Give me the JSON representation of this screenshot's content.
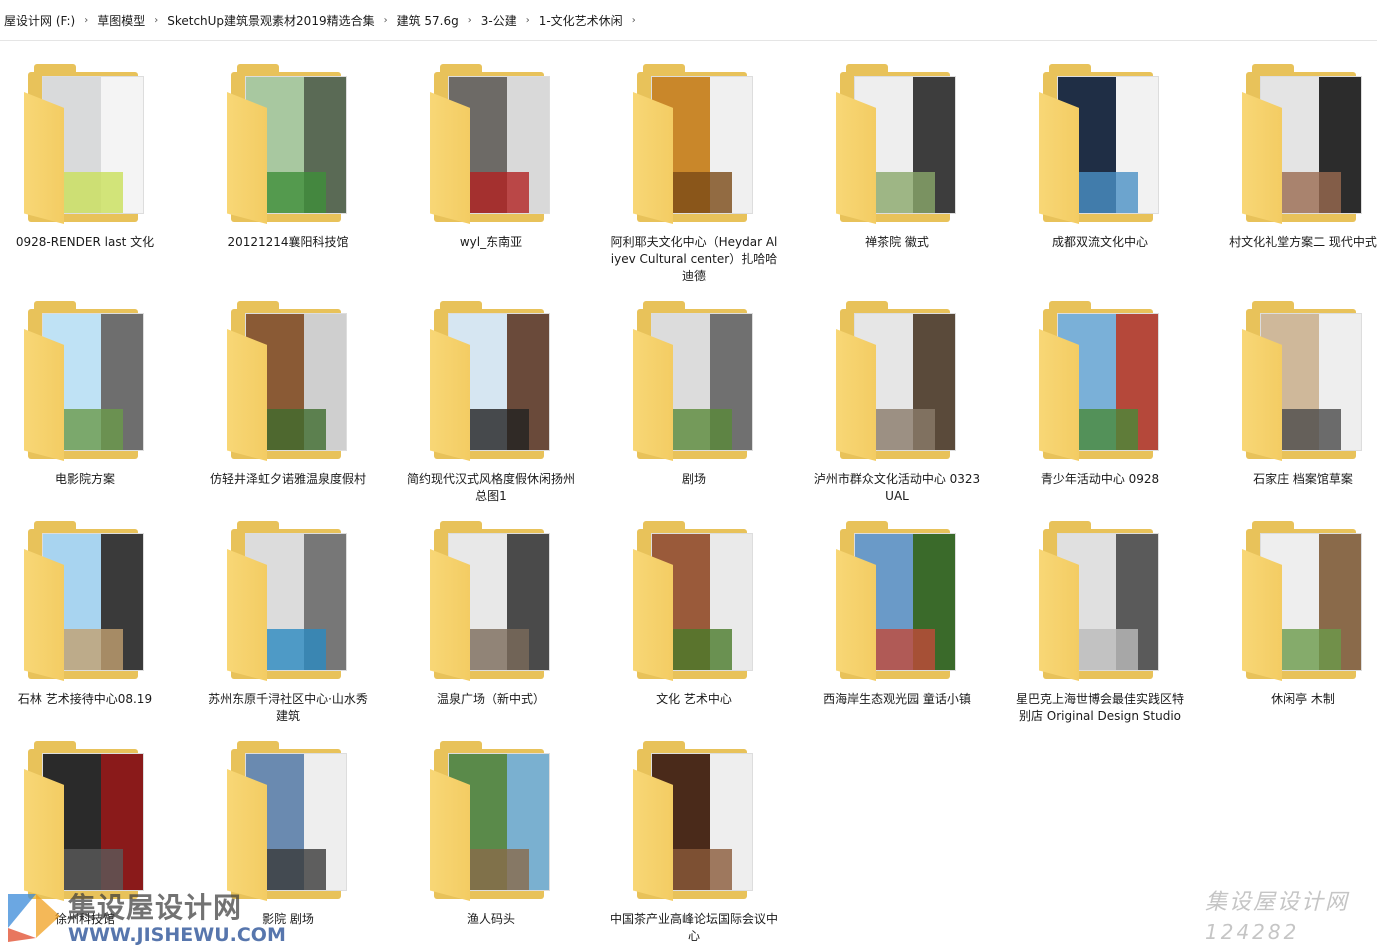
{
  "breadcrumb": [
    "屋设计网 (F:)",
    "草图模型",
    "SketchUp建筑景观素材2019精选合集",
    "建筑 57.6g",
    "3-公建",
    "1-文化艺术休闲"
  ],
  "folders": [
    {
      "name": "0928-RENDER last 文化",
      "colors": [
        "#d9dadb",
        "#f4f4f4",
        "#c9e05a"
      ]
    },
    {
      "name": "20121214襄阳科技馆",
      "colors": [
        "#a8c8a0",
        "#5a6a55",
        "#3f8f3a"
      ]
    },
    {
      "name": "wyl_东南亚",
      "colors": [
        "#6d6a66",
        "#d9d9d9",
        "#b22222"
      ]
    },
    {
      "name": "阿利耶夫文化中心（Heydar Aliyev Cultural center）扎哈哈迪德",
      "colors": [
        "#c9872a",
        "#f0f0f0",
        "#7a4a16"
      ]
    },
    {
      "name": "禅茶院 徽式",
      "colors": [
        "#eeeeee",
        "#3d3d3d",
        "#8aa86a"
      ]
    },
    {
      "name": "成都双流文化中心",
      "colors": [
        "#1f2e45",
        "#f2f2f2",
        "#4a90c4"
      ]
    },
    {
      "name": "村文化礼堂方案二 现代中式",
      "colors": [
        "#e4e4e4",
        "#2c2c2c",
        "#9a6a50"
      ]
    },
    {
      "name": "电影院方案",
      "colors": [
        "#bfe2f5",
        "#6e6e6e",
        "#6a9a4a"
      ]
    },
    {
      "name": "仿轻井泽虹夕诺雅温泉度假村",
      "colors": [
        "#8a5a35",
        "#cfcfcf",
        "#3e6b2e"
      ]
    },
    {
      "name": "简约现代汉式风格度假休闲扬州总图1",
      "colors": [
        "#d6e6f2",
        "#6a4a3a",
        "#222222"
      ]
    },
    {
      "name": "剧场",
      "colors": [
        "#dcdcdc",
        "#707070",
        "#5a8a3a"
      ]
    },
    {
      "name": "泸州市群众文化活动中心 0323 UAL",
      "colors": [
        "#e6e6e6",
        "#5a4a3a",
        "#8a7a6a"
      ]
    },
    {
      "name": "青少年活动中心 0928",
      "colors": [
        "#7ab0d8",
        "#b5483a",
        "#4a8a3a"
      ]
    },
    {
      "name": "石家庄 档案馆草案",
      "colors": [
        "#cfb89a",
        "#eeeeee",
        "#4a4a4a"
      ]
    },
    {
      "name": "石林 艺术接待中心08.19",
      "colors": [
        "#a8d4f0",
        "#3a3a3a",
        "#c2a070"
      ]
    },
    {
      "name": "苏州东原千浔社区中心·山水秀建筑",
      "colors": [
        "#dcdcdc",
        "#777777",
        "#2a8ac0"
      ]
    },
    {
      "name": "温泉广场（新中式）",
      "colors": [
        "#e8e8e8",
        "#4a4a4a",
        "#7a6a5a"
      ]
    },
    {
      "name": "文化 艺术中心",
      "colors": [
        "#9a5a3a",
        "#eaeaea",
        "#4a7a2a"
      ]
    },
    {
      "name": "西海岸生态观光园 童话小镇",
      "colors": [
        "#6a9ac8",
        "#3a6a2a",
        "#c24a3a"
      ]
    },
    {
      "name": "星巴克上海世博会最佳实践区特别店 Original Design Studio",
      "colors": [
        "#e0e0e0",
        "#5a5a5a",
        "#bababa"
      ]
    },
    {
      "name": "休闲亭 木制",
      "colors": [
        "#eeeeee",
        "#8a6a4a",
        "#6a9a4a"
      ]
    },
    {
      "name": "徐州科技馆",
      "colors": [
        "#2a2a2a",
        "#8a1a1a",
        "#5a5a5a"
      ]
    },
    {
      "name": "影院 剧场",
      "colors": [
        "#6a8ab0",
        "#eeeeee",
        "#3a3a3a"
      ]
    },
    {
      "name": "渔人码头",
      "colors": [
        "#5a8a4a",
        "#7ab0d0",
        "#8a6a4a"
      ]
    },
    {
      "name": "中国茶产业高峰论坛国际会议中心",
      "colors": [
        "#4a2a1a",
        "#eeeeee",
        "#8a5a3a"
      ]
    }
  ],
  "watermark": {
    "left_title": "集设屋设计网",
    "left_url": "WWW.JISHEWU.COM",
    "right_title": "集设屋设计网",
    "right_number": "124282",
    "logo_colors": [
      "#3a8ad8",
      "#f0a020",
      "#e04a2a"
    ]
  }
}
